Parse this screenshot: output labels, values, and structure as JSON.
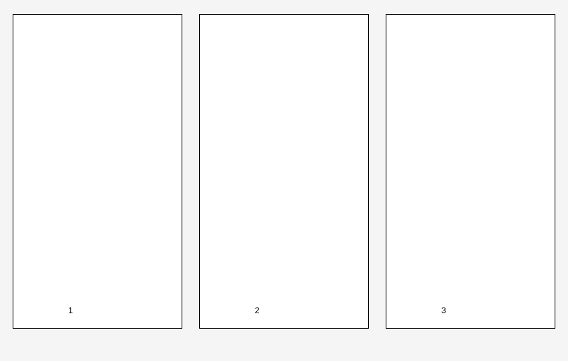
{
  "pages": [
    {
      "number": "1"
    },
    {
      "number": "2"
    },
    {
      "number": "3"
    }
  ],
  "watermark": ""
}
